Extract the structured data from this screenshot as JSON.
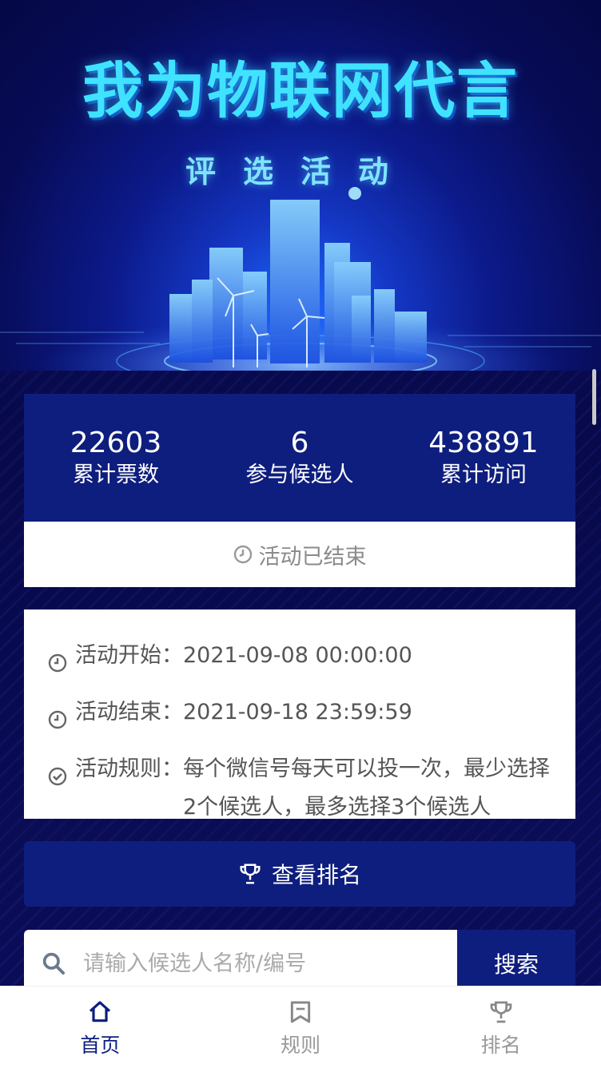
{
  "hero": {
    "title": "我为物联网代言",
    "subtitle": "评选活动"
  },
  "stats": [
    {
      "value": "22603",
      "label": "累计票数"
    },
    {
      "value": "6",
      "label": "参与候选人"
    },
    {
      "value": "438891",
      "label": "累计访问"
    }
  ],
  "status": {
    "text": "活动已结束",
    "icon": "clock-icon"
  },
  "info": {
    "start": {
      "key": "活动开始：",
      "value": "2021-09-08 00:00:00",
      "icon": "clock-icon"
    },
    "end": {
      "key": "活动结束：",
      "value": "2021-09-18 23:59:59",
      "icon": "clock-icon"
    },
    "rules": {
      "key": "活动规则：",
      "value": "每个微信号每天可以投一次，最少选择2个候选人，最多选择3个候选人",
      "icon": "check-circle-icon"
    }
  },
  "ranking_button": {
    "label": "查看排名",
    "icon": "trophy-icon"
  },
  "search": {
    "placeholder": "请输入候选人名称/编号",
    "value": "",
    "button_label": "搜索",
    "icon": "search-icon"
  },
  "tabbar": [
    {
      "label": "首页",
      "icon": "home-icon",
      "active": true
    },
    {
      "label": "规则",
      "icon": "rules-icon",
      "active": false
    },
    {
      "label": "排名",
      "icon": "trophy-icon",
      "active": false
    }
  ],
  "colors": {
    "primary": "#0e1e7e",
    "accent": "#3fe3ff",
    "background": "#0a0f4a",
    "muted_text": "#8a8a8a"
  }
}
